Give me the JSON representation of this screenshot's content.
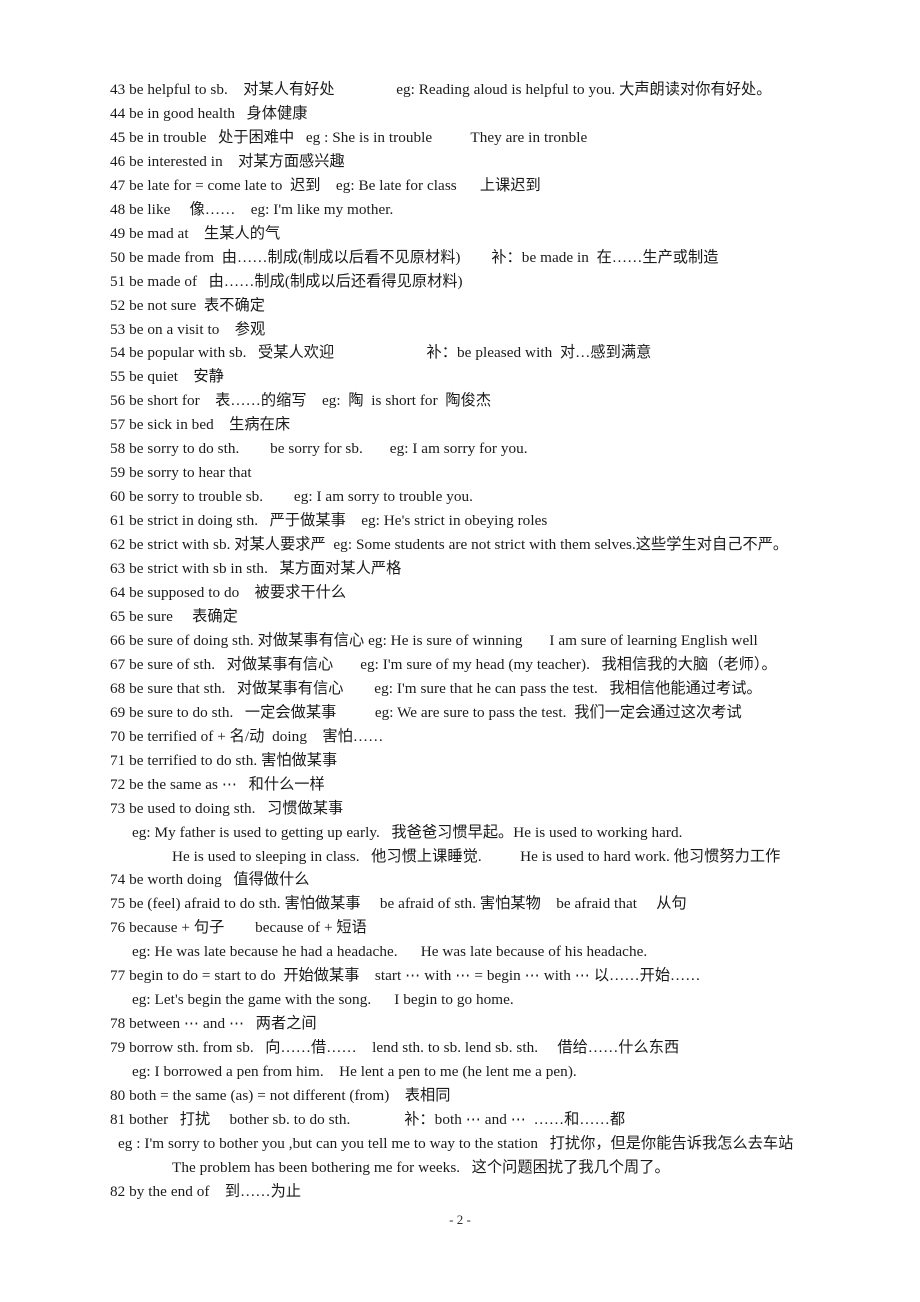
{
  "document": {
    "page_number_label": "- 2 -",
    "lines": [
      {
        "indent": 0,
        "text": "43 be helpful to sb.    对某人有好处                eg: Reading aloud is helpful to you. 大声朗读对你有好处。"
      },
      {
        "indent": 0,
        "text": "44 be in good health   身体健康"
      },
      {
        "indent": 0,
        "text": "45 be in trouble   处于困难中   eg : She is in trouble          They are in tronble"
      },
      {
        "indent": 0,
        "text": "46 be interested in    对某方面感兴趣"
      },
      {
        "indent": 0,
        "text": "47 be late for = come late to  迟到    eg: Be late for class      上课迟到"
      },
      {
        "indent": 0,
        "text": "48 be like     像……    eg: I'm like my mother."
      },
      {
        "indent": 0,
        "text": "49 be mad at    生某人的气"
      },
      {
        "indent": 0,
        "text": "50 be made from  由……制成(制成以后看不见原材料)        补：be made in  在……生产或制造"
      },
      {
        "indent": 0,
        "text": "51 be made of   由……制成(制成以后还看得见原材料)"
      },
      {
        "indent": 0,
        "text": "52 be not sure  表不确定"
      },
      {
        "indent": 0,
        "text": "53 be on a visit to    参观"
      },
      {
        "indent": 0,
        "text": "54 be popular with sb.   受某人欢迎                        补：be pleased with  对…感到满意"
      },
      {
        "indent": 0,
        "text": "55 be quiet    安静"
      },
      {
        "indent": 0,
        "text": "56 be short for    表……的缩写    eg:  陶  is short for  陶俊杰"
      },
      {
        "indent": 0,
        "text": "57 be sick in bed    生病在床"
      },
      {
        "indent": 0,
        "text": "58 be sorry to do sth.        be sorry for sb.       eg: I am sorry for you."
      },
      {
        "indent": 0,
        "text": "59 be sorry to hear that"
      },
      {
        "indent": 0,
        "text": "60 be sorry to trouble sb.        eg: I am sorry to trouble you."
      },
      {
        "indent": 0,
        "text": "61 be strict in doing sth.   严于做某事    eg: He's strict in obeying roles"
      },
      {
        "indent": 0,
        "text": "62 be strict with sb. 对某人要求严  eg: Some students are not strict with them selves.这些学生对自己不严。"
      },
      {
        "indent": 0,
        "text": "63 be strict with sb in sth.   某方面对某人严格"
      },
      {
        "indent": 0,
        "text": "64 be supposed to do    被要求干什么"
      },
      {
        "indent": 0,
        "text": "65 be sure     表确定"
      },
      {
        "indent": 0,
        "text": "66 be sure of doing sth. 对做某事有信心 eg: He is sure of winning       I am sure of learning English well"
      },
      {
        "indent": 0,
        "text": "67 be sure of sth.   对做某事有信心       eg: I'm sure of my head (my teacher).   我相信我的大脑（老师）。"
      },
      {
        "indent": 0,
        "text": "68 be sure that sth.   对做某事有信心        eg: I'm sure that he can pass the test.   我相信他能通过考试。"
      },
      {
        "indent": 0,
        "text": "69 be sure to do sth.   一定会做某事          eg: We are sure to pass the test.  我们一定会通过这次考试"
      },
      {
        "indent": 0,
        "text": "70 be terrified of + 名/动  doing    害怕……"
      },
      {
        "indent": 0,
        "text": "71 be terrified to do sth. 害怕做某事"
      },
      {
        "indent": 0,
        "text": "72 be the same as ⋯   和什么一样"
      },
      {
        "indent": 0,
        "text": "73 be used to doing sth.   习惯做某事"
      },
      {
        "indent": 1,
        "text": "eg: My father is used to getting up early.   我爸爸习惯早起。He is used to working hard."
      },
      {
        "indent": 2,
        "text": "He is used to sleeping in class.   他习惯上课睡觉.          He is used to hard work. 他习惯努力工作"
      },
      {
        "indent": 0,
        "text": "74 be worth doing   值得做什么"
      },
      {
        "indent": 0,
        "text": "75 be (feel) afraid to do sth. 害怕做某事     be afraid of sth. 害怕某物    be afraid that     从句"
      },
      {
        "indent": 0,
        "text": "76 because + 句子        because of + 短语"
      },
      {
        "indent": 1,
        "text": "eg: He was late because he had a headache.      He was late because of his headache."
      },
      {
        "indent": 0,
        "text": "77 begin to do = start to do  开始做某事    start ⋯ with ⋯ = begin ⋯ with ⋯ 以……开始……"
      },
      {
        "indent": 1,
        "text": "eg: Let's begin the game with the song.      I begin to go home."
      },
      {
        "indent": 0,
        "text": "78 between ⋯ and ⋯   两者之间"
      },
      {
        "indent": 0,
        "text": "79 borrow sth. from sb.   向……借……    lend sth. to sb. lend sb. sth.     借给……什么东西"
      },
      {
        "indent": 1,
        "text": "eg: I borrowed a pen from him.    He lent a pen to me (he lent me a pen)."
      },
      {
        "indent": 0,
        "text": "80 both = the same (as) = not different (from)    表相同"
      },
      {
        "indent": 0,
        "text": "81 bother   打扰     bother sb. to do sth.              补：both ⋯ and ⋯  ……和……都"
      },
      {
        "indent": 3,
        "text": "eg : I'm sorry to bother you ,but can you tell me to way to the station   打扰你，但是你能告诉我怎么去车站"
      },
      {
        "indent": 2,
        "text": "The problem has been bothering me for weeks.   这个问题困扰了我几个周了。"
      },
      {
        "indent": 0,
        "text": "82 by the end of    到……为止"
      }
    ]
  }
}
